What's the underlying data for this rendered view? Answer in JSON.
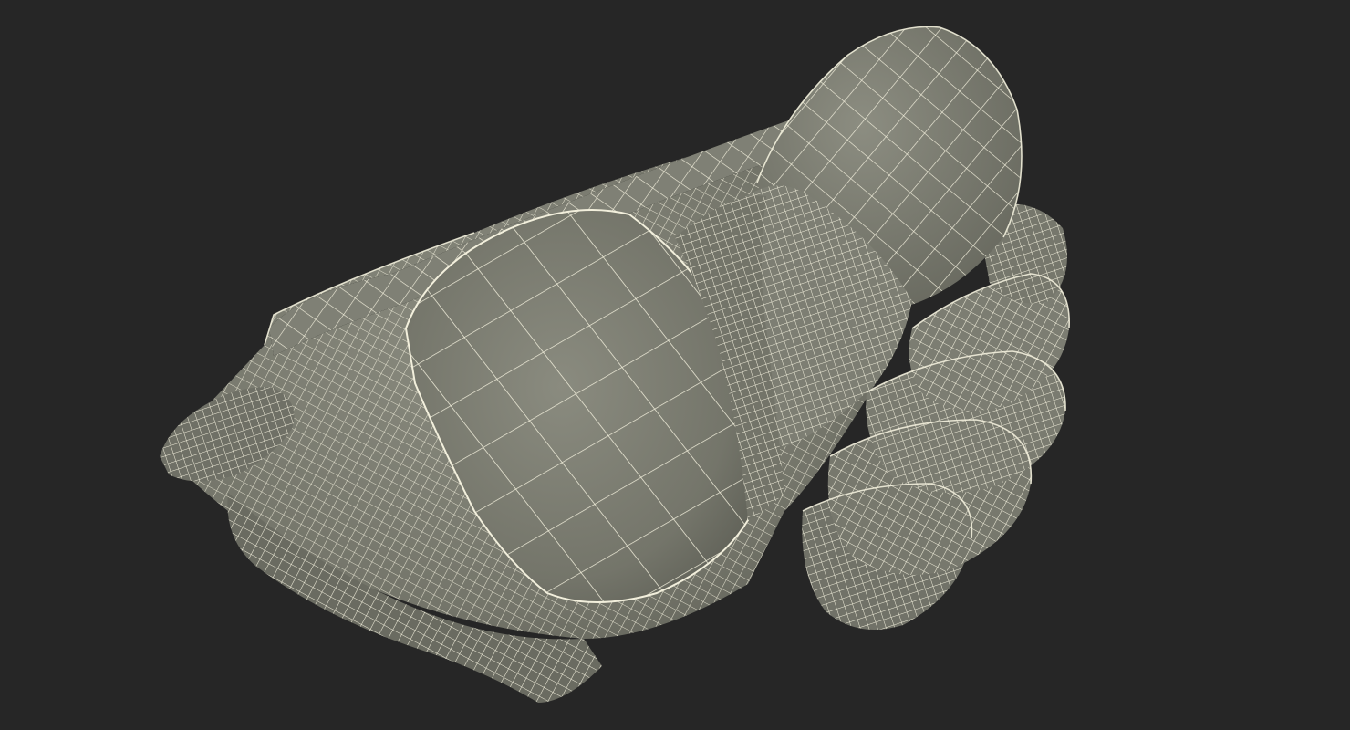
{
  "scene": {
    "background_color": "#262626",
    "surface_color": "#7b7c70",
    "surface_highlight": "#8e8f83",
    "surface_shadow": "#5f6056",
    "wire_color": "#f2efdc",
    "subject": "wireframe-glove-model"
  }
}
